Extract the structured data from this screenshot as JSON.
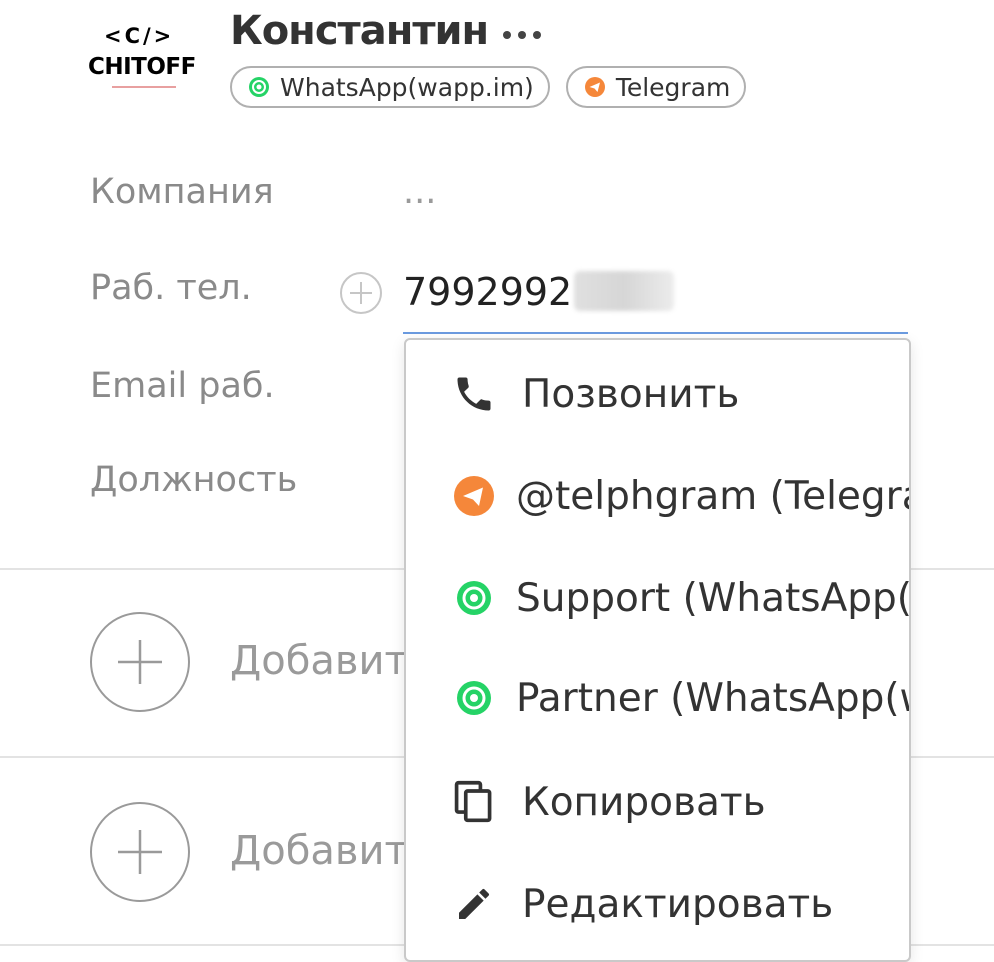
{
  "logo": {
    "code": "<C/>",
    "name": "CHITOFF"
  },
  "header": {
    "name": "Константин",
    "more_icon": "more-horizontal-icon",
    "channels": [
      {
        "label": "WhatsApp(wapp.im)",
        "icon": "whatsapp-icon",
        "color": "#25d366"
      },
      {
        "label": "Telegram",
        "icon": "telegram-icon",
        "color": "#f5873a"
      }
    ]
  },
  "fields": {
    "company": {
      "label": "Компания",
      "value": "..."
    },
    "work_phone": {
      "label": "Раб. тел.",
      "value": "7992992"
    },
    "work_email": {
      "label": "Email раб."
    },
    "position": {
      "label": "Должность"
    }
  },
  "add_sections": [
    {
      "label": "Добавить"
    },
    {
      "label": "Добавить"
    }
  ],
  "context_menu": {
    "items": [
      {
        "label": "Позвонить",
        "icon": "phone-icon"
      },
      {
        "label": "@telphgram (Telegram)",
        "icon": "telegram-icon"
      },
      {
        "label": "Support (WhatsApp(wapp.im))",
        "icon": "whatsapp-icon"
      },
      {
        "label": "Partner (WhatsApp(wapp.im))",
        "icon": "whatsapp-icon"
      },
      {
        "label": "Копировать",
        "icon": "copy-icon"
      },
      {
        "label": "Редактировать",
        "icon": "pencil-icon"
      }
    ]
  },
  "colors": {
    "telegram": "#f5873a",
    "whatsapp": "#25d366",
    "input_underline": "#6b9be0"
  }
}
